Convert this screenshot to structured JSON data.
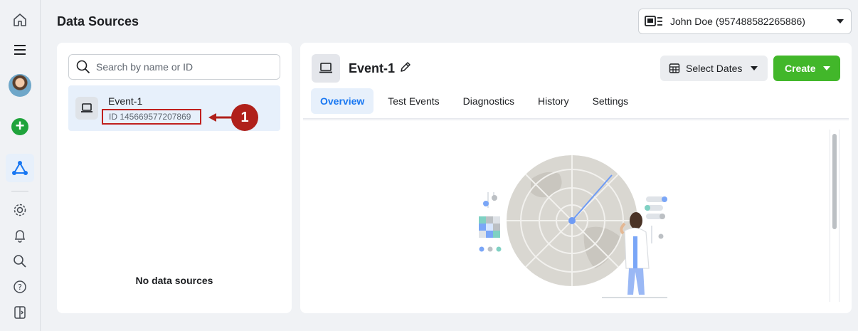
{
  "header": {
    "title": "Data Sources",
    "account_label": "John Doe (957488582265886)"
  },
  "rail": {
    "items": [
      "home",
      "menu",
      "avatar",
      "create",
      "data-sources",
      "settings",
      "notifications",
      "search",
      "help",
      "sidebar-toggle"
    ]
  },
  "sources_panel": {
    "search_placeholder": "Search by name or ID",
    "items": [
      {
        "name": "Event-1",
        "id_text": "ID 145669577207869"
      }
    ],
    "empty_text": "No data sources"
  },
  "annotation": {
    "number": "1"
  },
  "detail": {
    "title": "Event-1",
    "select_dates_label": "Select Dates",
    "create_label": "Create",
    "tabs": [
      "Overview",
      "Test Events",
      "Diagnostics",
      "History",
      "Settings"
    ],
    "active_tab": "Overview"
  },
  "colors": {
    "accent": "#1877f2",
    "create_green": "#42b72a",
    "annotation_red": "#b0201a",
    "selected_bg": "#e7f0fb"
  }
}
